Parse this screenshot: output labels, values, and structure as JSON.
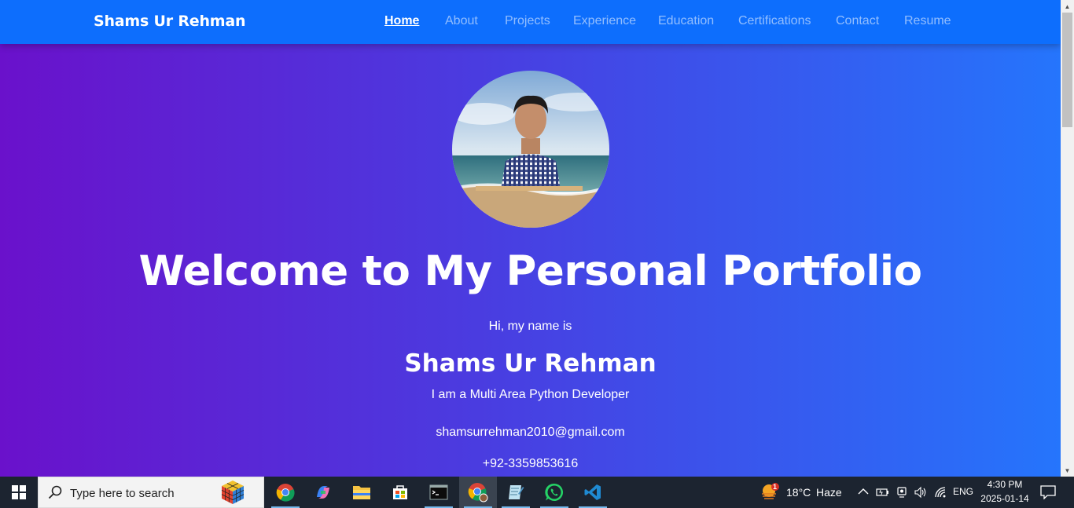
{
  "navbar": {
    "brand": "Shams Ur Rehman",
    "links": [
      {
        "label": "Home",
        "active": true
      },
      {
        "label": "About"
      },
      {
        "label": "Projects"
      },
      {
        "label": "Experience"
      },
      {
        "label": "Education"
      },
      {
        "label": "Certifications"
      },
      {
        "label": "Contact"
      },
      {
        "label": "Resume"
      }
    ]
  },
  "hero": {
    "title": "Welcome to My Personal Portfolio",
    "greeting": "Hi, my name is",
    "name": "Shams Ur Rehman",
    "tagline": "I am a Multi Area Python Developer",
    "email": "shamsurrehman2010@gmail.com",
    "phone": "+92-3359853616"
  },
  "taskbar": {
    "search_placeholder": "Type here to search",
    "weather_temp": "18°C",
    "weather_text": "Haze",
    "weather_badge": "1",
    "language": "ENG",
    "time": "4:30 PM",
    "date": "2025-01-14",
    "apps": [
      "chrome-icon",
      "copilot-icon",
      "file-explorer-icon",
      "store-icon",
      "terminal-icon",
      "chrome-profile-icon",
      "notepad-icon",
      "whatsapp-icon",
      "vscode-icon"
    ]
  },
  "colors": {
    "navbar": "#0d6efd",
    "gradient_start": "#6a11cb",
    "gradient_end": "#2575fc",
    "taskbar": "#1c2430"
  }
}
